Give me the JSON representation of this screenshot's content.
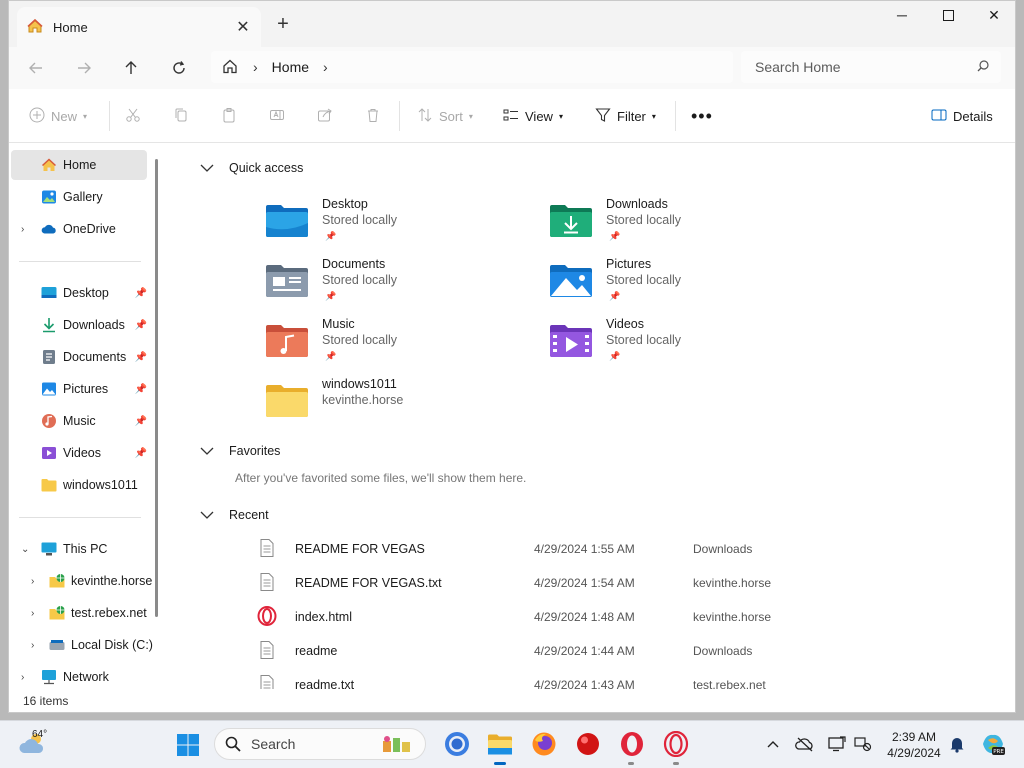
{
  "window": {
    "tab_title": "Home",
    "tab_icon": "home-icon"
  },
  "address": {
    "crumb": "Home",
    "search_placeholder": "Search Home"
  },
  "toolbar": {
    "new_label": "New",
    "sort_label": "Sort",
    "view_label": "View",
    "filter_label": "Filter",
    "details_label": "Details"
  },
  "sidebar": {
    "items": [
      {
        "label": "Home",
        "icon": "home-icon",
        "selected": true
      },
      {
        "label": "Gallery",
        "icon": "gallery-icon"
      },
      {
        "label": "OneDrive",
        "icon": "cloud-icon"
      },
      {
        "label": "Desktop",
        "icon": "desktop-icon",
        "pinned": true
      },
      {
        "label": "Downloads",
        "icon": "download-icon",
        "pinned": true
      },
      {
        "label": "Documents",
        "icon": "document-icon",
        "pinned": true
      },
      {
        "label": "Pictures",
        "icon": "picture-icon",
        "pinned": true
      },
      {
        "label": "Music",
        "icon": "music-icon",
        "pinned": true
      },
      {
        "label": "Videos",
        "icon": "video-icon",
        "pinned": true
      },
      {
        "label": "windows1011",
        "icon": "folder-icon"
      },
      {
        "label": "This PC",
        "icon": "pc-icon"
      },
      {
        "label": "kevinthe.horse",
        "icon": "network-drive-icon"
      },
      {
        "label": "test.rebex.net",
        "icon": "network-drive-icon"
      },
      {
        "label": "Local Disk (C:)",
        "icon": "disk-icon"
      },
      {
        "label": "Network",
        "icon": "network-icon"
      }
    ]
  },
  "quick_access": {
    "title": "Quick access",
    "items": [
      {
        "name": "Desktop",
        "sub": "Stored locally",
        "pinned": true,
        "icon": "desktop-folder-icon"
      },
      {
        "name": "Downloads",
        "sub": "Stored locally",
        "pinned": true,
        "icon": "downloads-folder-icon"
      },
      {
        "name": "Documents",
        "sub": "Stored locally",
        "pinned": true,
        "icon": "documents-folder-icon"
      },
      {
        "name": "Pictures",
        "sub": "Stored locally",
        "pinned": true,
        "icon": "pictures-folder-icon"
      },
      {
        "name": "Music",
        "sub": "Stored locally",
        "pinned": true,
        "icon": "music-folder-icon"
      },
      {
        "name": "Videos",
        "sub": "Stored locally",
        "pinned": true,
        "icon": "videos-folder-icon"
      },
      {
        "name": "windows1011",
        "sub": "kevinthe.horse",
        "pinned": false,
        "icon": "folder-icon"
      }
    ]
  },
  "favorites": {
    "title": "Favorites",
    "empty_text": "After you've favorited some files, we'll show them here."
  },
  "recent": {
    "title": "Recent",
    "rows": [
      {
        "name": "README FOR VEGAS",
        "date": "4/29/2024 1:55 AM",
        "location": "Downloads",
        "icon": "text-file-icon"
      },
      {
        "name": "README FOR VEGAS.txt",
        "date": "4/29/2024 1:54 AM",
        "location": "kevinthe.horse",
        "icon": "text-file-icon"
      },
      {
        "name": "index.html",
        "date": "4/29/2024 1:48 AM",
        "location": "kevinthe.horse",
        "icon": "opera-html-icon"
      },
      {
        "name": "readme",
        "date": "4/29/2024 1:44 AM",
        "location": "Downloads",
        "icon": "text-file-icon"
      },
      {
        "name": "readme.txt",
        "date": "4/29/2024 1:43 AM",
        "location": "test.rebex.net",
        "icon": "text-file-icon"
      }
    ]
  },
  "status": {
    "item_count": "16 items"
  },
  "taskbar": {
    "temperature": "64°",
    "search_label": "Search",
    "time": "2:39 AM",
    "date": "4/29/2024"
  },
  "colors": {
    "accent": "#0067c0",
    "folder_yellow": "#f7c948",
    "selected_bg": "#e5e5e5"
  }
}
